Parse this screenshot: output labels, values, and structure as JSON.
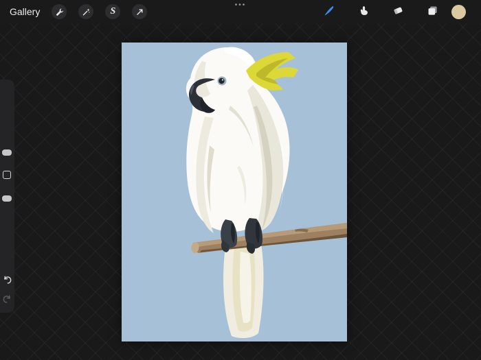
{
  "topbar": {
    "gallery_label": "Gallery",
    "selection_glyph": "S",
    "center_dots": "•••",
    "accent_color": "#3a88e8",
    "color_swatch": "#d9c8a0",
    "left_tools": [
      {
        "label": "Actions",
        "icon": "wrench-icon"
      },
      {
        "label": "Adjustments",
        "icon": "magic-wand-icon"
      },
      {
        "label": "Selection",
        "icon": "selection-s-icon"
      },
      {
        "label": "Transform",
        "icon": "transform-arrow-icon"
      }
    ],
    "right_tools": [
      {
        "label": "Paint",
        "icon": "brush-icon",
        "active": true
      },
      {
        "label": "Smudge",
        "icon": "smudge-finger-icon"
      },
      {
        "label": "Erase",
        "icon": "eraser-icon"
      },
      {
        "label": "Layers",
        "icon": "layers-icon"
      },
      {
        "label": "Color",
        "icon": "color-swatch-circle"
      }
    ]
  },
  "sidebar": {
    "controls": [
      {
        "name": "brush-size-slider"
      },
      {
        "name": "modify-button"
      },
      {
        "name": "opacity-slider"
      },
      {
        "name": "undo-button"
      },
      {
        "name": "redo-button"
      }
    ]
  },
  "canvas": {
    "background_color": "#a6c0d8",
    "subject": "White sulphur-crested cockatoo with yellow crest perched on a brown branch",
    "palette": {
      "body_white": "#fbfaf6",
      "shading_warm_gray": "#d7d3c3",
      "crest_yellow": "#dcd837",
      "beak_dark": "#2c3138",
      "eye_dark": "#23272d",
      "branch_brown": "#9d8061",
      "branch_shadow": "#6e5438",
      "branch_highlight": "#b79b79",
      "tail_cream": "#f1eee2"
    }
  }
}
